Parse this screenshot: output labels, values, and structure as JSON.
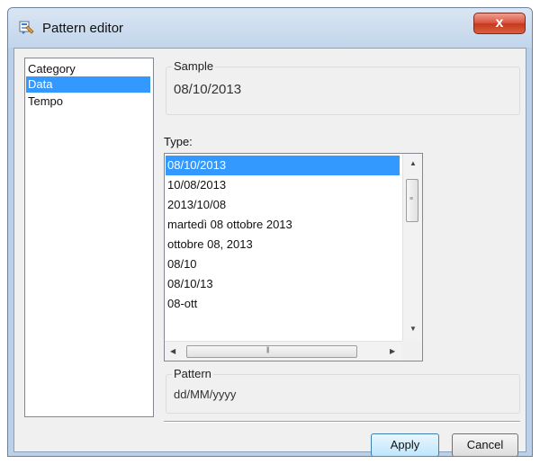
{
  "window": {
    "title": "Pattern editor",
    "close_glyph": "x"
  },
  "category": {
    "header": "Category",
    "items": [
      {
        "label": "Data",
        "selected": true
      },
      {
        "label": "Tempo",
        "selected": false
      }
    ]
  },
  "sample": {
    "legend": "Sample",
    "value": "08/10/2013"
  },
  "type": {
    "label": "Type:",
    "items": [
      {
        "label": "08/10/2013",
        "selected": true
      },
      {
        "label": "10/08/2013",
        "selected": false
      },
      {
        "label": "2013/10/08",
        "selected": false
      },
      {
        "label": "martedì 08 ottobre 2013",
        "selected": false
      },
      {
        "label": "ottobre 08, 2013",
        "selected": false
      },
      {
        "label": "08/10",
        "selected": false
      },
      {
        "label": "08/10/13",
        "selected": false
      },
      {
        "label": "08-ott",
        "selected": false
      }
    ]
  },
  "pattern": {
    "legend": "Pattern",
    "value": "dd/MM/yyyy"
  },
  "buttons": {
    "apply": "Apply",
    "cancel": "Cancel"
  },
  "colors": {
    "selection": "#3399ff",
    "close_button": "#c7381f",
    "title_bar": "#c2d5ea"
  },
  "icons": {
    "app": "pattern-editor-app-icon",
    "close": "close-icon"
  }
}
